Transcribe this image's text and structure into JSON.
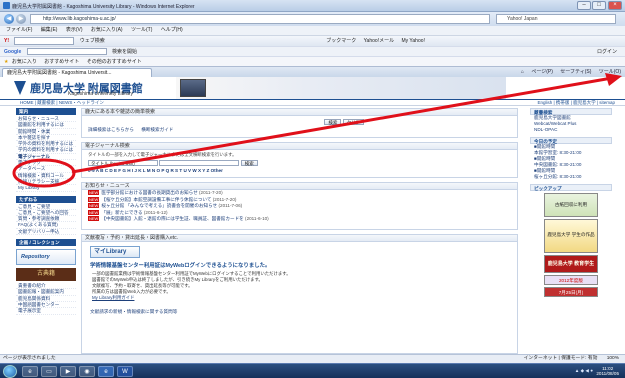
{
  "window": {
    "title": "鹿児島大学附属図書館 - Kagoshima University Library - Windows Internet Explorer"
  },
  "address": {
    "url": "http://www.lib.kagoshima-u.ac.jp/",
    "search_placeholder": "Yahoo! Japan"
  },
  "menu": [
    "ファイル(F)",
    "編集(E)",
    "表示(V)",
    "お気に入り(A)",
    "ツール(T)",
    "ヘルプ(H)"
  ],
  "toolbar1": {
    "search_hint": "ウェブ検索",
    "bookmarks": "ブックマーク",
    "yahoo_mail": "Yahoo!メール",
    "my_yahoo": "My Yahoo!"
  },
  "toolbar2": {
    "google_search": "検索を開始",
    "login": "ログイン"
  },
  "toolbar3": {
    "favorites": "お気に入り",
    "suggested": "おすすめサイト",
    "more": "その他のおすすめサイト"
  },
  "tab": {
    "title": "鹿児島大学附属図書館 - Kagoshima Universit..."
  },
  "commandbar": {
    "page": "ページ(P)",
    "safety": "セーフティ(S)",
    "tools": "ツール(O)"
  },
  "header": {
    "title": "鹿児島大学 附属図書館",
    "subtitle": "Kagoshima University Library",
    "subnav_left": "HOME | 蔵書検索 | NEWS・ヘッドライン",
    "subnav_right": "English | 携帯版 | 鹿児島大学 | sitemap"
  },
  "left_nav": {
    "section1": "案内",
    "items1": [
      "お知らせ・ニュース",
      "図書館を利用するには",
      "開館時間・休業",
      "本や雑誌を探す",
      "学外の資料を利用するには",
      "学内の資料を利用するには",
      "電子ジャーナル",
      "電子ブック",
      "データベース",
      "情報検索・資料コール",
      "情報リテラシー支援",
      "My Library"
    ],
    "section2": "たずねる",
    "items2": [
      "ご意見・ご要望",
      "ご意見・ご要望への回答",
      "質問・参考調査依頼",
      "FAQ(よくある質問)",
      "文献デリバリー申込"
    ],
    "section3": "企画 / コレクション",
    "banner1": "Repository",
    "banner2": "古典籍",
    "items3": [
      "貴重書の紹介",
      "図書館報・図書館案内",
      "鹿児島関係資料",
      "中国語図書センター",
      "電子展示室"
    ]
  },
  "main": {
    "search_box": {
      "heading": "鹿大にある本や雑誌の簡単検索",
      "detail_link": "詳細検索はこちらから",
      "multi_link": "横断検索ガイド",
      "search_btn": "検索",
      "clear_btn": "クリア"
    },
    "ej_box": {
      "heading": "電子ジャーナル検索",
      "note": "タイトルの一部を入力して電子ジャーナルまたは全文横断検索を行います。",
      "select_value": "タイトル (begins with)",
      "search_btn": "検索",
      "alphabet": "0-9 A B C D E F G H I J K L M N O P Q R S T U V W X Y Z Other"
    },
    "news_box": {
      "heading": "お知らせ・ニュース",
      "items": [
        {
          "text": "医学部分館における図書の長期貸出のお知らせ",
          "date": "(2011-7-20)"
        },
        {
          "text": "【桜ケ丘分館】本館空調設備工事に伴う休館について",
          "date": "(2011-7-20)"
        },
        {
          "text": "桜ヶ丘分館 「みんなで考える」読書会を開催のお知らせ",
          "date": "(2011-7-06)"
        },
        {
          "text": "「展」新たにできる",
          "date": "(2011-6-12)"
        },
        {
          "text": "【中央図書館】入館・退館の際には学生証、職員証、図書館カードを",
          "date": "(2011-6-10)"
        }
      ]
    },
    "notice_box": {
      "heading": "文献複写・予約・貸出延長・図書購入etc.",
      "mylib": "マイLibrary",
      "title": "学術情報基盤センター利用証はMyWebログインできるようになりました。",
      "line1": "一部の図書館業務は学術情報基盤センター利用証でMyWebにログインすることで利用いただけます。",
      "line2": "図書館でのMyWeb申込は終了しましたが、引き続きMy Libraryをご利用いただけます。",
      "line3": "文献複写、予約・取寄せ、貸出延長等が可能です。",
      "line4": "所属の方は図書館Web入力が必要です。",
      "link1": "My Library利用ガイド",
      "link2": "文献請求の新規・情報検索に関する質問等"
    }
  },
  "right_col": {
    "db_head": "蔵書検索",
    "db_lines": [
      "鹿児島大学図書館",
      "Webcat/Webcat Plus",
      "NDL-OPAC"
    ],
    "today_head": "今日の予定",
    "today_lines": [
      "■開館時間",
      "本館学習室: 8:30-21:00",
      "■開館時間",
      "中央図書館: 8:30-21:00",
      "■開館時間",
      "桜ヶ丘分館: 8:30-21:00"
    ],
    "pickup_head": "ピックアップ",
    "ads": [
      "古紙回収に利用",
      "鹿児島大学 学生の作品",
      "鹿児島大学 教育学生",
      "2012年度版",
      "7月25日(月)"
    ]
  },
  "status": {
    "left": "ページが表示されました",
    "zone": "インターネット | 保護モード: 有効",
    "zoom": "100%"
  },
  "taskbar": {
    "time": "11:02",
    "date": "2011/08/05"
  }
}
